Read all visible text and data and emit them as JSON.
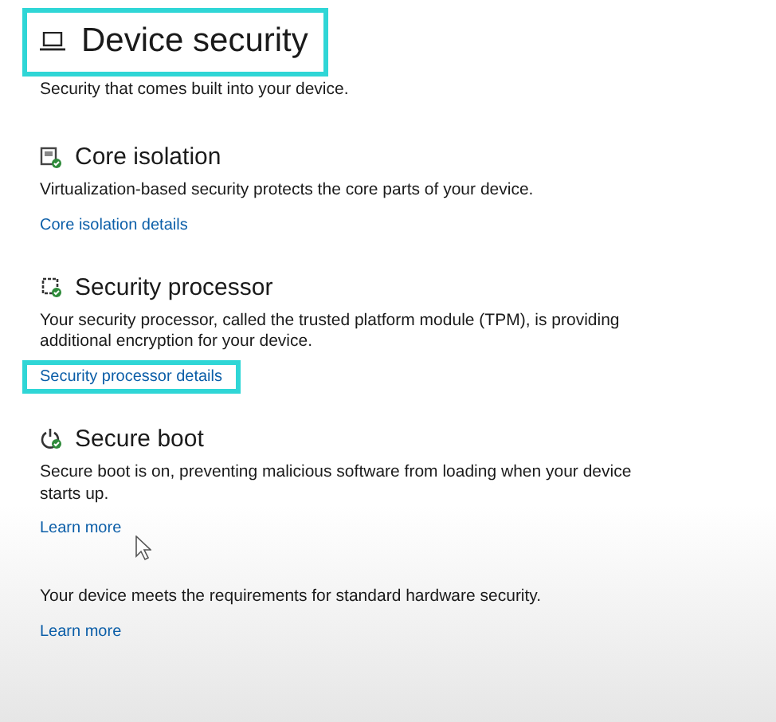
{
  "page": {
    "title": "Device security",
    "title_highlighted": true,
    "subtitle": "Security that comes built into your device."
  },
  "sections": [
    {
      "kind": "core-isolation",
      "heading": "Core isolation",
      "text": "Virtualization-based security protects the core parts of your device.",
      "link": "Core isolation details",
      "link_highlighted": false
    },
    {
      "kind": "processor",
      "heading": "Security processor",
      "text": "Your security processor, called the trusted platform module (TPM), is providing additional encryption for your device.",
      "link": "Security processor details",
      "link_highlighted": true
    },
    {
      "kind": "secure-boot",
      "heading": "Secure boot",
      "text": "Secure boot is on, preventing malicious software from loading when your device starts up.",
      "link": "Learn more",
      "link_highlighted": false
    }
  ],
  "footer": {
    "text": "Your device meets the requirements for standard hardware security.",
    "link": "Learn more"
  }
}
